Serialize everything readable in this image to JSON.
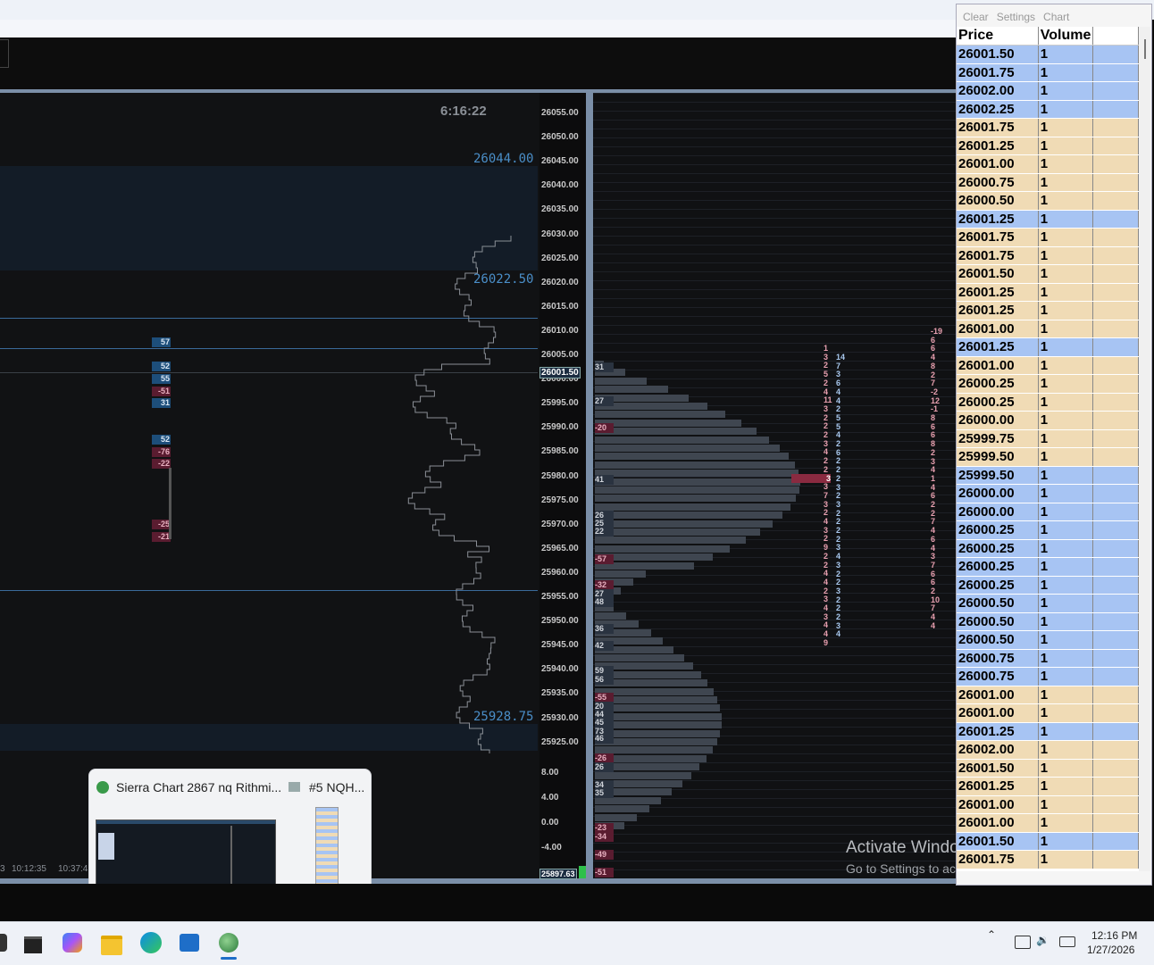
{
  "chart_left": {
    "clock": "6:16:22",
    "price_labels": [
      "26044.00",
      "26022.50",
      "25928.75"
    ],
    "price_ticks": [
      "26055.00",
      "26050.00",
      "26045.00",
      "26040.00",
      "26035.00",
      "26030.00",
      "26025.00",
      "26020.00",
      "26015.00",
      "26010.00",
      "26005.00",
      "26000.00",
      "25995.00",
      "25990.00",
      "25985.00",
      "25980.00",
      "25975.00",
      "25970.00",
      "25965.00",
      "25960.00",
      "25955.00",
      "25950.00",
      "25945.00",
      "25940.00",
      "25935.00",
      "25930.00",
      "25925.00"
    ],
    "current_price_box": "26001.50",
    "sub_ticks": [
      "8.00",
      "4.00",
      "0.00",
      "-4.00"
    ],
    "bottom_box": "25897.63",
    "time_axis": [
      "3",
      "10:12:35",
      "10:37:4"
    ],
    "delta_badges": [
      {
        "v": "57",
        "c": "blue"
      },
      {
        "v": "52",
        "c": "blue"
      },
      {
        "v": "55",
        "c": "blue"
      },
      {
        "v": "-51",
        "c": "red"
      },
      {
        "v": "31",
        "c": "blue"
      },
      {
        "v": "52",
        "c": "blue"
      },
      {
        "v": "-76",
        "c": "red"
      },
      {
        "v": "-22",
        "c": "red"
      },
      {
        "v": "-25",
        "c": "red"
      },
      {
        "v": "-21",
        "c": "red"
      }
    ]
  },
  "chart_right": {
    "left_labels": [
      "31",
      "27",
      "-20",
      "41",
      "26",
      "25",
      "22",
      "-57",
      "-32",
      "27",
      "48",
      "36",
      "42",
      "59",
      "56",
      "-55",
      "20",
      "44",
      "45",
      "73",
      "46",
      "-26",
      "26",
      "34",
      "35",
      "-23",
      "-34",
      "-49",
      "-51"
    ],
    "col_a": [
      "1",
      "3",
      "2",
      "5",
      "2",
      "4",
      "11",
      "3",
      "2",
      "2",
      "2",
      "3",
      "4",
      "2",
      "2",
      "3",
      "3",
      "7",
      "3",
      "2",
      "4",
      "3",
      "2",
      "9",
      "2",
      "2",
      "4",
      "4",
      "2",
      "3",
      "4",
      "3",
      "4",
      "4",
      "9"
    ],
    "col_b": [
      "14",
      "7",
      "3",
      "6",
      "4",
      "4",
      "2",
      "5",
      "5",
      "4",
      "2",
      "6",
      "2",
      "2",
      "2",
      "3",
      "2",
      "3",
      "2",
      "2",
      "2",
      "2",
      "3",
      "4",
      "3",
      "2",
      "2",
      "3",
      "2",
      "2",
      "2",
      "3",
      "4"
    ],
    "col_c": [
      "-19",
      "6",
      "6",
      "4",
      "8",
      "2",
      "7",
      "-2",
      "12",
      "-1",
      "8",
      "6",
      "6",
      "8",
      "2",
      "3",
      "4",
      "1",
      "4",
      "6",
      "2",
      "2",
      "7",
      "4",
      "6",
      "4",
      "3",
      "7",
      "6",
      "6",
      "2",
      "10",
      "7",
      "4",
      "4"
    ],
    "highlight": "3",
    "activate_line1": "Activate Windows",
    "activate_line2": "Go to Settings to activate Windows."
  },
  "thumbnail": {
    "title": "Sierra Chart 2867 nq Rithmi...",
    "title2": "#5 NQH..."
  },
  "panel": {
    "menu": [
      "Clear",
      "Settings",
      "Chart"
    ],
    "col_price": "Price",
    "col_volume": "Volume",
    "rows": [
      {
        "p": "26001.50",
        "v": "1",
        "s": "b"
      },
      {
        "p": "26001.75",
        "v": "1",
        "s": "b"
      },
      {
        "p": "26002.00",
        "v": "1",
        "s": "b"
      },
      {
        "p": "26002.25",
        "v": "1",
        "s": "b"
      },
      {
        "p": "26001.75",
        "v": "1",
        "s": "t"
      },
      {
        "p": "26001.25",
        "v": "1",
        "s": "t"
      },
      {
        "p": "26001.00",
        "v": "1",
        "s": "t"
      },
      {
        "p": "26000.75",
        "v": "1",
        "s": "t"
      },
      {
        "p": "26000.50",
        "v": "1",
        "s": "t"
      },
      {
        "p": "26001.25",
        "v": "1",
        "s": "b"
      },
      {
        "p": "26001.75",
        "v": "1",
        "s": "t"
      },
      {
        "p": "26001.75",
        "v": "1",
        "s": "t"
      },
      {
        "p": "26001.50",
        "v": "1",
        "s": "t"
      },
      {
        "p": "26001.25",
        "v": "1",
        "s": "t"
      },
      {
        "p": "26001.25",
        "v": "1",
        "s": "t"
      },
      {
        "p": "26001.00",
        "v": "1",
        "s": "t"
      },
      {
        "p": "26001.25",
        "v": "1",
        "s": "b"
      },
      {
        "p": "26001.00",
        "v": "1",
        "s": "t"
      },
      {
        "p": "26000.25",
        "v": "1",
        "s": "t"
      },
      {
        "p": "26000.25",
        "v": "1",
        "s": "t"
      },
      {
        "p": "26000.00",
        "v": "1",
        "s": "t"
      },
      {
        "p": "25999.75",
        "v": "1",
        "s": "t"
      },
      {
        "p": "25999.50",
        "v": "1",
        "s": "t"
      },
      {
        "p": "25999.50",
        "v": "1",
        "s": "b"
      },
      {
        "p": "26000.00",
        "v": "1",
        "s": "b"
      },
      {
        "p": "26000.00",
        "v": "1",
        "s": "b"
      },
      {
        "p": "26000.25",
        "v": "1",
        "s": "b"
      },
      {
        "p": "26000.25",
        "v": "1",
        "s": "b"
      },
      {
        "p": "26000.25",
        "v": "1",
        "s": "b"
      },
      {
        "p": "26000.25",
        "v": "1",
        "s": "b"
      },
      {
        "p": "26000.50",
        "v": "1",
        "s": "b"
      },
      {
        "p": "26000.50",
        "v": "1",
        "s": "b"
      },
      {
        "p": "26000.50",
        "v": "1",
        "s": "b"
      },
      {
        "p": "26000.75",
        "v": "1",
        "s": "b"
      },
      {
        "p": "26000.75",
        "v": "1",
        "s": "b"
      },
      {
        "p": "26001.00",
        "v": "1",
        "s": "t"
      },
      {
        "p": "26001.00",
        "v": "1",
        "s": "t"
      },
      {
        "p": "26001.25",
        "v": "1",
        "s": "b"
      },
      {
        "p": "26002.00",
        "v": "1",
        "s": "t"
      },
      {
        "p": "26001.50",
        "v": "1",
        "s": "t"
      },
      {
        "p": "26001.25",
        "v": "1",
        "s": "t"
      },
      {
        "p": "26001.00",
        "v": "1",
        "s": "t"
      },
      {
        "p": "26001.00",
        "v": "1",
        "s": "t"
      },
      {
        "p": "26001.50",
        "v": "1",
        "s": "b"
      },
      {
        "p": "26001.75",
        "v": "1",
        "s": "t"
      }
    ]
  },
  "taskbar": {
    "time": "12:16 PM",
    "date": "1/27/2026",
    "icons": [
      "windows-icon",
      "terminal-icon",
      "copilot-icon",
      "file-explorer-icon",
      "edge-icon",
      "outlook-icon",
      "sierra-chart-icon"
    ]
  },
  "colors": {
    "buy_row": "#a7c4f3",
    "sell_row": "#f0dbb5",
    "pos_delta": "#1d4e7a",
    "neg_delta": "#5a1c30",
    "price_label": "#4a8ec8"
  }
}
